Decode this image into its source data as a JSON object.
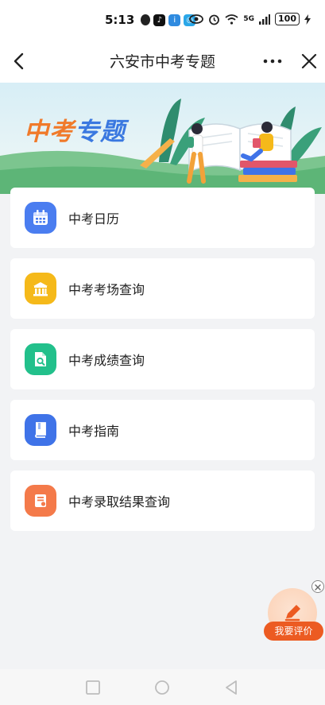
{
  "status_bar": {
    "time": "5:13",
    "network": "5G",
    "battery": "100",
    "icons": [
      "qq-icon",
      "tiktok-icon",
      "info-app-icon",
      "search-app-icon",
      "eye-icon",
      "alarm-icon",
      "wifi-icon",
      "signal-icon",
      "charging-icon"
    ]
  },
  "nav": {
    "title": "六安市中考专题",
    "icons": [
      "back-arrow-icon",
      "more-icon",
      "close-icon"
    ]
  },
  "banner": {
    "title_part1": "中考",
    "title_part2": "专题"
  },
  "menu": {
    "items": [
      {
        "label": "中考日历",
        "icon": "calendar-icon",
        "color": "#4a7df0"
      },
      {
        "label": "中考考场查询",
        "icon": "building-icon",
        "color": "#f5b91a"
      },
      {
        "label": "中考成绩查询",
        "icon": "document-search-icon",
        "color": "#22c08b"
      },
      {
        "label": "中考指南",
        "icon": "book-icon",
        "color": "#3f73e8"
      },
      {
        "label": "中考录取结果查询",
        "icon": "certificate-icon",
        "color": "#f47a4a"
      }
    ]
  },
  "review": {
    "label": "我要评价",
    "icon": "pencil-icon"
  },
  "system_nav": {
    "icons": [
      "recent-apps-icon",
      "home-icon",
      "back-triangle-icon"
    ]
  },
  "colors": {
    "accent_orange": "#ec5b22",
    "banner_blue": "#3a78e0",
    "banner_orange": "#f07a2a"
  }
}
